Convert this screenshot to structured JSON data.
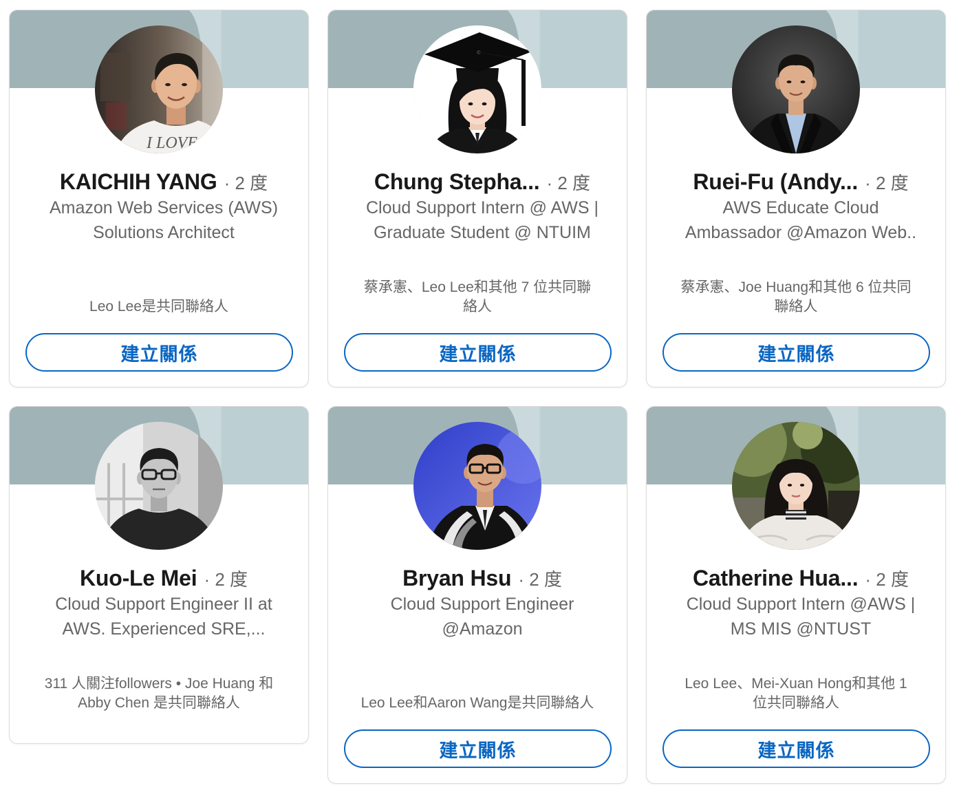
{
  "colors": {
    "banner_base": "#a0b4b7",
    "banner_band": "#cad9dc",
    "banner_right": "#bccfd3",
    "name_text": "#191919",
    "secondary_text": "#666666",
    "accent": "#0a66c2",
    "card_border": "#dedcd9"
  },
  "cards": [
    {
      "name": "KAICHIH YANG",
      "degree": "· 2 度",
      "headline": [
        "Amazon Web Services (AWS)",
        "Solutions Architect"
      ],
      "insights": [
        "Leo Lee是共同聯絡人"
      ],
      "button": "建立關係",
      "photo_text": "I LOVE"
    },
    {
      "name": "Chung Stepha...",
      "degree": "· 2 度",
      "headline": [
        "Cloud Support Intern @ AWS |",
        "Graduate Student @ NTUIM"
      ],
      "insights": [
        "蔡承憲、Leo Lee和其他 7 位共同聯",
        "絡人"
      ],
      "button": "建立關係"
    },
    {
      "name": "Ruei-Fu (Andy...",
      "degree": "· 2 度",
      "headline": [
        "AWS Educate Cloud",
        "Ambassador @Amazon Web.."
      ],
      "insights": [
        "蔡承憲、Joe Huang和其他 6 位共同",
        "聯絡人"
      ],
      "button": "建立關係"
    },
    {
      "name": "Kuo-Le Mei",
      "degree": "· 2 度",
      "headline": [
        "Cloud Support Engineer II at",
        "AWS. Experienced SRE,..."
      ],
      "insights": [
        "311 人關注followers • Joe Huang 和",
        "Abby Chen 是共同聯絡人"
      ]
    },
    {
      "name": "Bryan Hsu",
      "degree": "· 2 度",
      "headline": [
        "Cloud Support Engineer",
        "@Amazon"
      ],
      "insights": [
        "Leo Lee和Aaron Wang是共同聯絡人"
      ],
      "button": "建立關係"
    },
    {
      "name": "Catherine Hua...",
      "degree": "· 2 度",
      "headline": [
        "Cloud Support Intern @AWS |",
        "MS MIS @NTUST"
      ],
      "insights": [
        "Leo Lee、Mei-Xuan Hong和其他 1",
        "位共同聯絡人"
      ],
      "button": "建立關係"
    }
  ]
}
